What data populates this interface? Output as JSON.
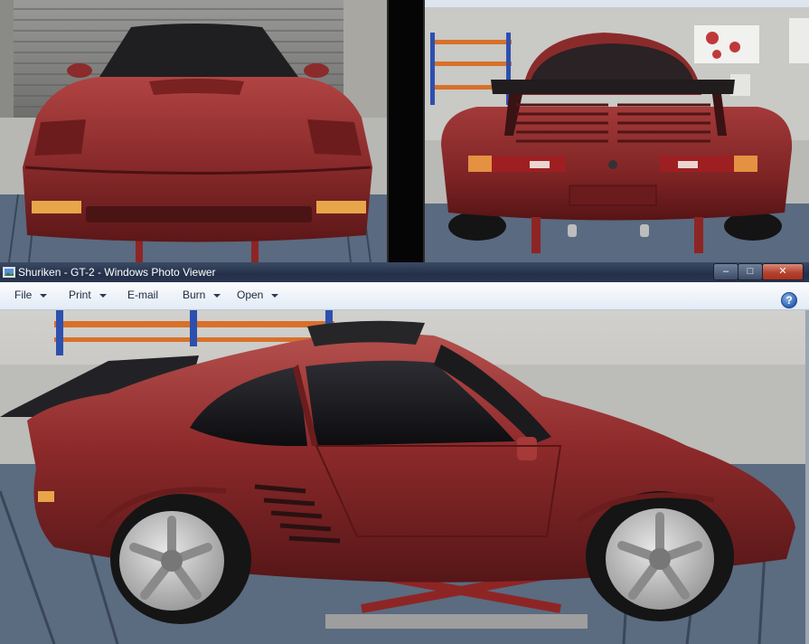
{
  "window": {
    "title": "Shuriken - GT-2 - Windows Photo Viewer",
    "controls": {
      "minimize": "–",
      "maximize": "□",
      "close": "✕"
    }
  },
  "menu": {
    "items": [
      {
        "label": "File",
        "has_dropdown": true
      },
      {
        "label": "Print",
        "has_dropdown": true
      },
      {
        "label": "E-mail",
        "has_dropdown": false
      },
      {
        "label": "Burn",
        "has_dropdown": true
      },
      {
        "label": "Open",
        "has_dropdown": true
      }
    ],
    "help_label": "?"
  },
  "icons": {
    "title_icon": "photo-viewer-icon",
    "help": "help-icon",
    "dropdown": "chevron-down-icon"
  },
  "colors": {
    "car_body": "#8e2a2b",
    "titlebar": "#2a3550",
    "menubar": "#e8eef6",
    "close_button": "#b4432f"
  }
}
